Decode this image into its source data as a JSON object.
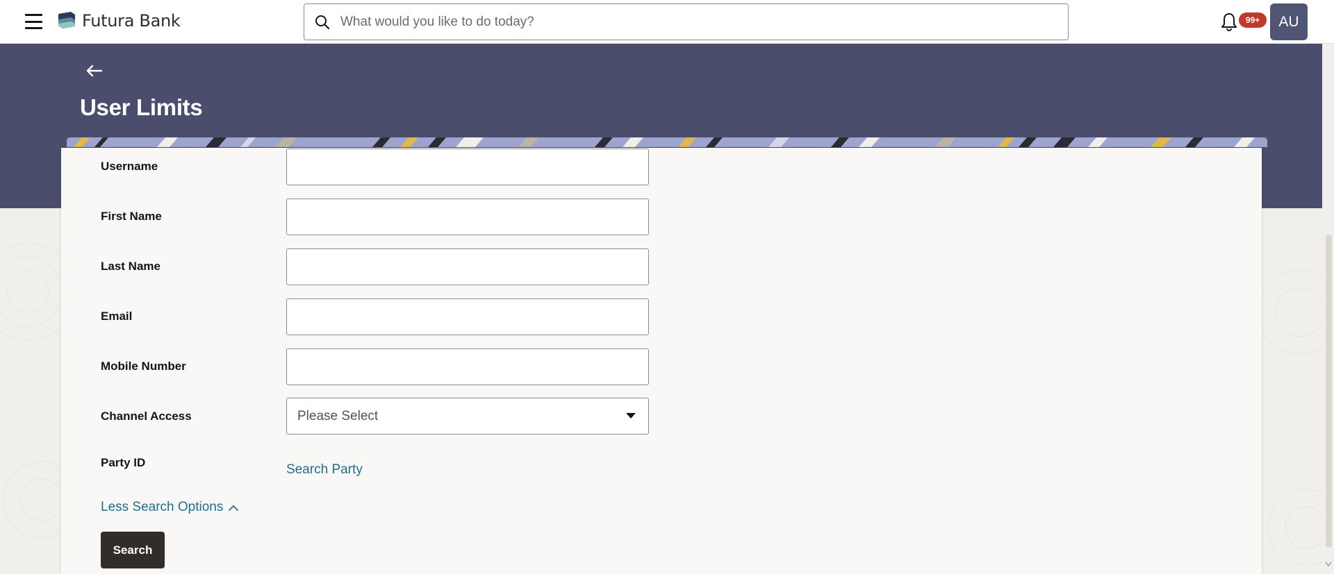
{
  "header": {
    "brand_name": "Futura Bank",
    "search_placeholder": "What would you like to do today?",
    "notification_count": "99+",
    "user_initials": "AU"
  },
  "page": {
    "title": "User Limits"
  },
  "form": {
    "username_label": "Username",
    "first_name_label": "First Name",
    "last_name_label": "Last Name",
    "email_label": "Email",
    "mobile_label": "Mobile Number",
    "channel_access_label": "Channel Access",
    "channel_access_value": "Please Select",
    "party_id_label": "Party ID",
    "search_party_link": "Search Party",
    "less_options_link": "Less Search Options",
    "search_button": "Search"
  },
  "colors": {
    "hero_band": "#4a4d6b",
    "link": "#1f6d8f",
    "badge": "#c0392b",
    "avatar": "#505574",
    "button": "#312d2a"
  },
  "icons": [
    "menu-icon",
    "bank-logo-icon",
    "search-icon",
    "bell-icon",
    "back-arrow-icon",
    "chevron-down-icon",
    "chevron-up-icon"
  ]
}
